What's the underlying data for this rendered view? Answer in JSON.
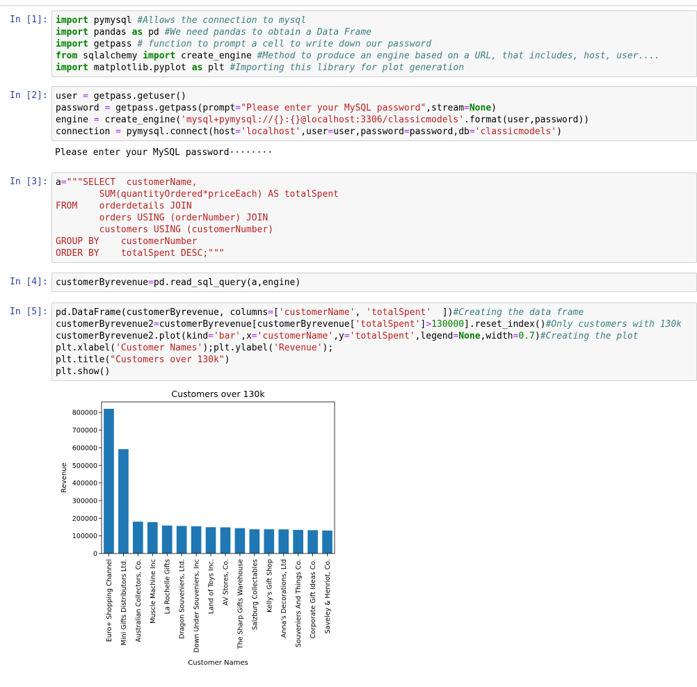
{
  "cells": [
    {
      "prompt": "In [1]:",
      "lines": [
        [
          [
            "kw",
            "import"
          ],
          [
            "t",
            " pymysql "
          ],
          [
            "cm",
            "#Allows the connection to mysql"
          ]
        ],
        [
          [
            "kw",
            "import"
          ],
          [
            "t",
            " pandas "
          ],
          [
            "kw",
            "as"
          ],
          [
            "t",
            " pd "
          ],
          [
            "cm",
            "#We need pandas to obtain a Data Frame"
          ]
        ],
        [
          [
            "kw",
            "import"
          ],
          [
            "t",
            " getpass "
          ],
          [
            "cm",
            "# function to prompt a cell to write down our password"
          ]
        ],
        [
          [
            "kw",
            "from"
          ],
          [
            "t",
            " sqlalchemy "
          ],
          [
            "kw",
            "import"
          ],
          [
            "t",
            " create_engine "
          ],
          [
            "cm",
            "#Method to produce an engine based on a URL, that includes, host, user...."
          ]
        ],
        [
          [
            "kw",
            "import"
          ],
          [
            "t",
            " matplotlib.pyplot "
          ],
          [
            "kw",
            "as"
          ],
          [
            "t",
            " plt "
          ],
          [
            "cm",
            "#Importing this library for plot generation"
          ]
        ]
      ]
    },
    {
      "prompt": "In [2]:",
      "lines": [
        [
          [
            "t",
            "user "
          ],
          [
            "op",
            "="
          ],
          [
            "t",
            " getpass.getuser()"
          ]
        ],
        [
          [
            "t",
            "password "
          ],
          [
            "op",
            "="
          ],
          [
            "t",
            " getpass.getpass(prompt"
          ],
          [
            "op",
            "="
          ],
          [
            "st",
            "\"Please enter your MySQL password\""
          ],
          [
            "t",
            ",stream"
          ],
          [
            "op",
            "="
          ],
          [
            "kw",
            "None"
          ],
          [
            "t",
            ")"
          ]
        ],
        [
          [
            "t",
            "engine "
          ],
          [
            "op",
            "="
          ],
          [
            "t",
            " create_engine("
          ],
          [
            "st",
            "'mysql+pymysql://{}:{}@localhost:3306/classicmodels'"
          ],
          [
            "t",
            ".format(user,password))"
          ]
        ],
        [
          [
            "t",
            "connection "
          ],
          [
            "op",
            "="
          ],
          [
            "t",
            " pymysql.connect(host"
          ],
          [
            "op",
            "="
          ],
          [
            "st",
            "'localhost'"
          ],
          [
            "t",
            ",user"
          ],
          [
            "op",
            "="
          ],
          [
            "t",
            "user,password"
          ],
          [
            "op",
            "="
          ],
          [
            "t",
            "password,db"
          ],
          [
            "op",
            "="
          ],
          [
            "st",
            "'classicmodels'"
          ],
          [
            "t",
            ")"
          ]
        ]
      ],
      "output": "Please enter your MySQL password········"
    },
    {
      "prompt": "In [3]:",
      "lines": [
        [
          [
            "t",
            "a"
          ],
          [
            "op",
            "="
          ],
          [
            "st",
            "\"\"\"SELECT  customerName,"
          ]
        ],
        [
          [
            "st",
            "        SUM(quantityOrdered*priceEach) AS totalSpent"
          ]
        ],
        [
          [
            "st",
            "FROM    orderdetails JOIN"
          ]
        ],
        [
          [
            "st",
            "        orders USING (orderNumber) JOIN"
          ]
        ],
        [
          [
            "st",
            "        customers USING (customerNumber)"
          ]
        ],
        [
          [
            "st",
            "GROUP BY    customerNumber"
          ]
        ],
        [
          [
            "st",
            "ORDER BY    totalSpent DESC;\"\"\""
          ]
        ]
      ]
    },
    {
      "prompt": "In [4]:",
      "lines": [
        [
          [
            "t",
            "customerByrevenue"
          ],
          [
            "op",
            "="
          ],
          [
            "t",
            "pd.read_sql_query(a,engine)"
          ]
        ]
      ]
    },
    {
      "prompt": "In [5]:",
      "lines": [
        [
          [
            "t",
            "pd.DataFrame(customerByrevenue, columns"
          ],
          [
            "op",
            "="
          ],
          [
            "t",
            "["
          ],
          [
            "st",
            "'customerName'"
          ],
          [
            "t",
            ", "
          ],
          [
            "st",
            "'totalSpent'"
          ],
          [
            "t",
            "  ])"
          ],
          [
            "cm",
            "#Creating the data frame"
          ]
        ],
        [
          [
            "t",
            "customerByrevenue2"
          ],
          [
            "op",
            "="
          ],
          [
            "t",
            "customerByrevenue[customerByrevenue["
          ],
          [
            "st",
            "'totalSpent'"
          ],
          [
            "t",
            "]"
          ],
          [
            "op",
            ">"
          ],
          [
            "nm",
            "130000"
          ],
          [
            "t",
            "].reset_index()"
          ],
          [
            "cm",
            "#Only customers with 130k"
          ]
        ],
        [
          [
            "t",
            "customerByrevenue2.plot(kind"
          ],
          [
            "op",
            "="
          ],
          [
            "st",
            "'bar'"
          ],
          [
            "t",
            ",x"
          ],
          [
            "op",
            "="
          ],
          [
            "st",
            "'customerName'"
          ],
          [
            "t",
            ",y"
          ],
          [
            "op",
            "="
          ],
          [
            "st",
            "'totalSpent'"
          ],
          [
            "t",
            ",legend"
          ],
          [
            "op",
            "="
          ],
          [
            "kw",
            "None"
          ],
          [
            "t",
            ",width"
          ],
          [
            "op",
            "="
          ],
          [
            "nm",
            "0.7"
          ],
          [
            "t",
            ")"
          ],
          [
            "cm",
            "#Creating the plot"
          ]
        ],
        [
          [
            "t",
            "plt.xlabel("
          ],
          [
            "st",
            "'Customer Names'"
          ],
          [
            "t",
            ");plt.ylabel("
          ],
          [
            "st",
            "'Revenue'"
          ],
          [
            "t",
            ");"
          ]
        ],
        [
          [
            "t",
            "plt.title("
          ],
          [
            "st",
            "\"Customers over 130k\""
          ],
          [
            "t",
            ")"
          ]
        ],
        [
          [
            "t",
            "plt.show()"
          ]
        ]
      ]
    }
  ],
  "chart_data": {
    "type": "bar",
    "title": "Customers over 130k",
    "xlabel": "Customer Names",
    "ylabel": "Revenue",
    "ylim": [
      0,
      860000
    ],
    "yticks": [
      0,
      100000,
      200000,
      300000,
      400000,
      500000,
      600000,
      700000,
      800000
    ],
    "ytick_labels": [
      "0",
      "100000",
      "200000",
      "300000",
      "400000",
      "500000",
      "600000",
      "700000",
      "800000"
    ],
    "bar_color": "#1f77b4",
    "grid": false,
    "categories": [
      "Euro+ Shopping Channel",
      "Mini Gifts Distributors Ltd.",
      "Australian Collectors, Co.",
      "Muscle Machine Inc",
      "La Rochelle Gifts",
      "Dragon Souveniers, Ltd.",
      "Down Under Souveniers, Inc",
      "Land of Toys Inc.",
      "AV Stores, Co.",
      "The Sharp Gifts Warehouse",
      "Salzburg Collectables",
      "Kelly's Gift Shop",
      "Anna's Decorations, Ltd",
      "Souveniers And Things Co.",
      "Corporate Gift Ideas Co.",
      "Saveley & Henriot, Co."
    ],
    "values": [
      820690,
      591827,
      180585,
      177914,
      158573,
      156251,
      154622,
      149085,
      148410,
      143536,
      137480,
      137460,
      137035,
      133907,
      132341,
      130305
    ]
  }
}
